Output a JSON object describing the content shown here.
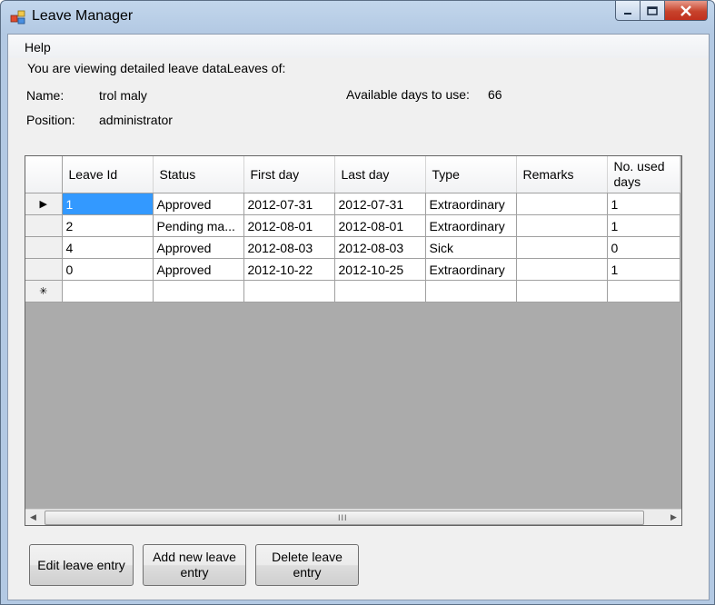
{
  "window": {
    "title": "Leave Manager"
  },
  "menu": {
    "help": "Help"
  },
  "info": {
    "intro": "You are viewing detailed leave dataLeaves of:",
    "name_label": "Name:",
    "name_value": "trol maly",
    "position_label": "Position:",
    "position_value": "administrator",
    "available_label": "Available days to use:",
    "available_value": "66"
  },
  "grid": {
    "columns": [
      "Leave Id",
      "Status",
      "First day",
      "Last day",
      "Type",
      "Remarks",
      "No. used days"
    ],
    "rows": [
      [
        "1",
        "Approved",
        "2012-07-31",
        "2012-07-31",
        "Extraordinary",
        "",
        "1"
      ],
      [
        "2",
        "Pending ma...",
        "2012-08-01",
        "2012-08-01",
        "Extraordinary",
        "",
        "1"
      ],
      [
        "4",
        "Approved",
        "2012-08-03",
        "2012-08-03",
        "Sick",
        "",
        "0"
      ],
      [
        "0",
        "Approved",
        "2012-10-22",
        "2012-10-25",
        "Extraordinary",
        "",
        "1"
      ]
    ],
    "new_row_marker": "✳",
    "current_row_marker": "▶",
    "scroll_grip": "III",
    "scroll_left": "◀",
    "scroll_right": "▶"
  },
  "buttons": {
    "edit": "Edit leave entry",
    "add": "Add new leave entry",
    "delete": "Delete leave entry"
  },
  "colors": {
    "selection": "#3399ff",
    "close_button": "#c7432c"
  }
}
